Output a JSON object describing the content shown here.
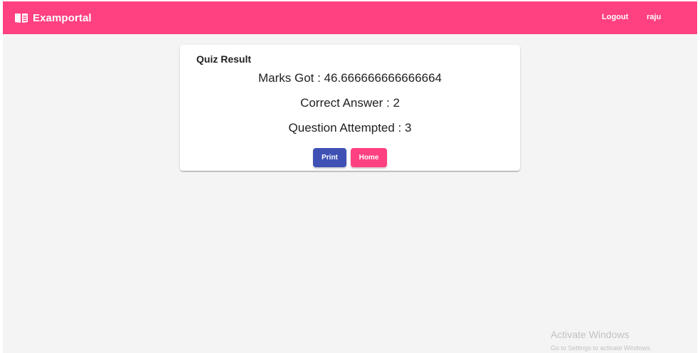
{
  "toolbar": {
    "brand_icon": "book-open-icon",
    "brand_title": "Examportal",
    "links": {
      "logout": "Logout",
      "user": "raju"
    },
    "color": "#ff4081"
  },
  "result_card": {
    "title": "Quiz Result",
    "marks_line": "Marks Got : 46.666666666666664",
    "correct_line": "Correct Answer : 2",
    "attempted_line": "Question Attempted : 3",
    "buttons": {
      "print": "Print",
      "home": "Home"
    },
    "colors": {
      "print": "#3f51b5",
      "home": "#ff4081"
    }
  },
  "watermark": {
    "title": "Activate Windows",
    "subtitle": "Go to Settings to activate Windows."
  }
}
